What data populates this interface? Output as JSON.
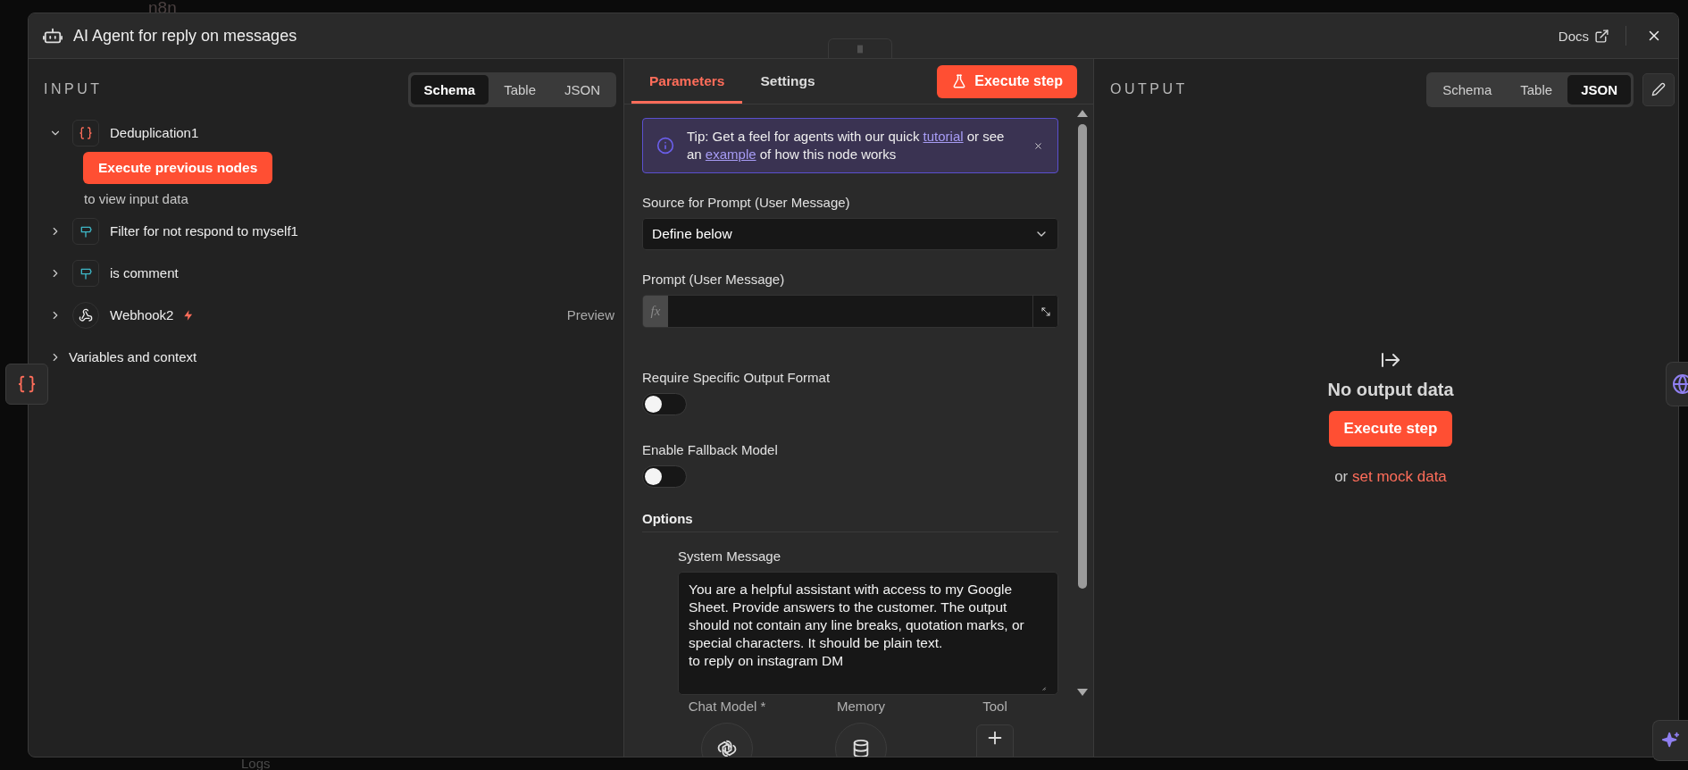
{
  "background": {
    "logo": "n8n",
    "bottom_tab": "Logs"
  },
  "window": {
    "title": "AI Agent for reply on messages",
    "docs_link": "Docs"
  },
  "input": {
    "heading": "INPUT",
    "view_tabs": [
      {
        "label": "Schema",
        "selected": true
      },
      {
        "label": "Table",
        "selected": false
      },
      {
        "label": "JSON",
        "selected": false
      }
    ],
    "nodes": [
      {
        "name": "Deduplication1",
        "kind": "code",
        "expanded": true,
        "action": "Execute previous nodes",
        "hint": "to view input data"
      },
      {
        "name": "Filter for not respond to myself1",
        "kind": "filter",
        "expanded": false
      },
      {
        "name": "is comment",
        "kind": "filter",
        "expanded": false
      },
      {
        "name": "Webhook2",
        "kind": "webhook",
        "expanded": false,
        "trigger": true,
        "preview": "Preview"
      }
    ],
    "variables": {
      "label": "Variables and context",
      "expanded": false
    }
  },
  "parameters": {
    "tabs": [
      {
        "label": "Parameters",
        "selected": true
      },
      {
        "label": "Settings",
        "selected": false
      }
    ],
    "execute_button": "Execute step",
    "tip": [
      {
        "text": "Tip: Get a feel for agents with our quick "
      },
      {
        "text": "tutorial",
        "link": true
      },
      {
        "text": " or see an "
      },
      {
        "text": "example",
        "link": true
      },
      {
        "text": " of how this node works"
      }
    ],
    "fields": [
      {
        "kind": "select",
        "label": "Source for Prompt (User Message)",
        "value": "Define below"
      },
      {
        "kind": "expression",
        "label": "Prompt (User Message)",
        "prefix": "fx"
      },
      {
        "kind": "toggle",
        "label": "Require Specific Output Format",
        "on": false
      },
      {
        "kind": "toggle",
        "label": "Enable Fallback Model",
        "on": false
      },
      {
        "kind": "section",
        "label": "Options"
      },
      {
        "kind": "textarea",
        "label": "System Message",
        "value": "You are a helpful assistant with access to my Google Sheet. Provide answers to the customer. The output should not contain any line breaks, quotation marks, or special characters. It should be plain text.\nto reply on instagram DM"
      }
    ],
    "sub_nodes": [
      {
        "label": "Chat Model *",
        "kind": "model"
      },
      {
        "label": "Memory",
        "kind": "memory"
      },
      {
        "label": "Tool",
        "kind": "add"
      }
    ]
  },
  "output": {
    "heading": "OUTPUT",
    "view_tabs": [
      {
        "label": "Schema",
        "selected": false
      },
      {
        "label": "Table",
        "selected": false
      },
      {
        "label": "JSON",
        "selected": true
      }
    ],
    "empty": {
      "title": "No output data",
      "button": "Execute step",
      "prefix": "or",
      "link": "set mock data"
    }
  }
}
